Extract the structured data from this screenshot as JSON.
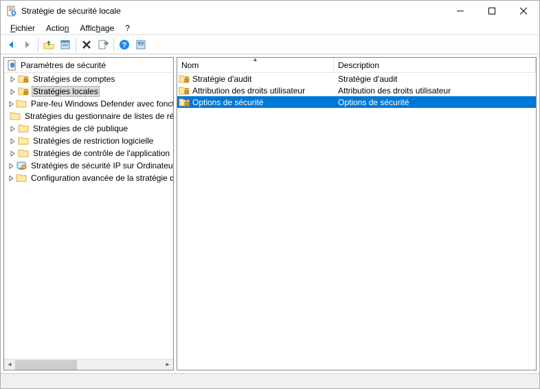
{
  "window": {
    "title": "Stratégie de sécurité locale"
  },
  "menubar": {
    "file": "Fichier",
    "action": "Action",
    "view": "Affichage",
    "help": "?"
  },
  "tree": {
    "header": "Paramètres de sécurité",
    "items": [
      {
        "label": "Stratégies de comptes",
        "icon": "folder-locked",
        "selected": false
      },
      {
        "label": "Stratégies locales",
        "icon": "folder-locked",
        "selected": true
      },
      {
        "label": "Pare-feu Windows Defender avec fonctions avancées de sécurité",
        "icon": "folder",
        "selected": false
      },
      {
        "label": "Stratégies du gestionnaire de listes de réseaux",
        "icon": "folder",
        "selected": false,
        "noExpander": true
      },
      {
        "label": "Stratégies de clé publique",
        "icon": "folder",
        "selected": false
      },
      {
        "label": "Stratégies de restriction logicielle",
        "icon": "folder",
        "selected": false
      },
      {
        "label": "Stratégies de contrôle de l'application",
        "icon": "folder",
        "selected": false
      },
      {
        "label": "Stratégies de sécurité IP sur Ordinateur local",
        "icon": "ipsec",
        "selected": false
      },
      {
        "label": "Configuration avancée de la stratégie d'audit",
        "icon": "folder",
        "selected": false
      }
    ]
  },
  "list": {
    "columns": {
      "name": "Nom",
      "description": "Description"
    },
    "rows": [
      {
        "name": "Stratégie d'audit",
        "description": "Stratégie d'audit",
        "icon": "folder-locked",
        "selected": false
      },
      {
        "name": "Attribution des droits utilisateur",
        "description": "Attribution des droits utilisateur",
        "icon": "folder-locked",
        "selected": false
      },
      {
        "name": "Options de sécurité",
        "description": "Options de sécurité",
        "icon": "folder-locked",
        "selected": true
      }
    ]
  }
}
